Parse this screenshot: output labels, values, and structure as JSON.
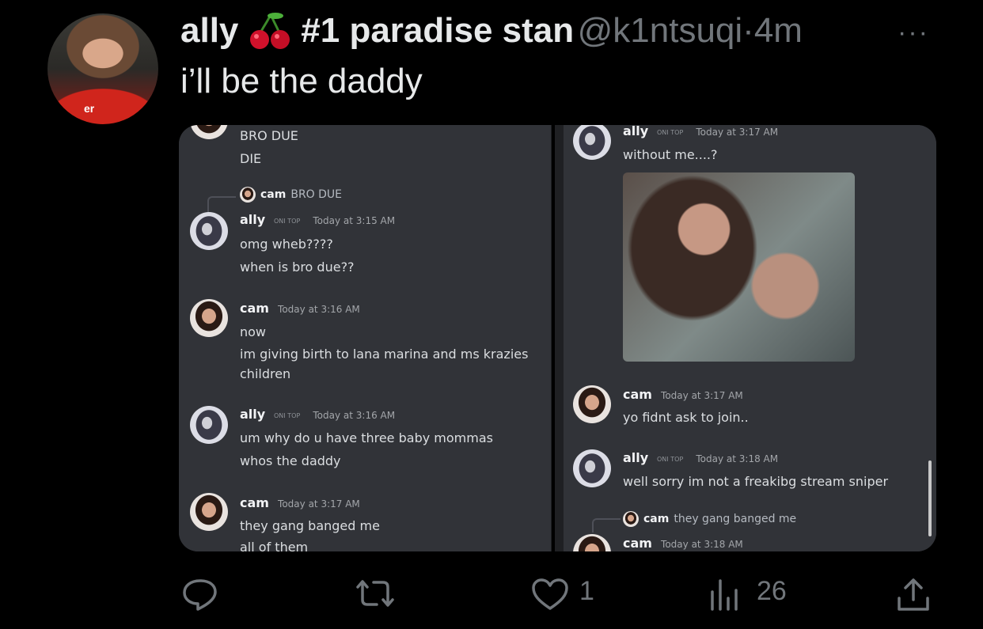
{
  "tweet": {
    "author_name": "ally",
    "author_suffix": "#1 paradise stan",
    "handle": "@k1ntsuqi",
    "separator": "·",
    "time": "4m",
    "more": "···",
    "text": "i’ll be the daddy",
    "avatar_badge": "er"
  },
  "left_panel": {
    "top_lines": [
      "BRO DUE",
      "DIE"
    ],
    "reply1": {
      "user": "cam",
      "text": "BRO DUE"
    },
    "messages": [
      {
        "user": "ally",
        "tags": [
          "ONI",
          "TOP"
        ],
        "time": "Today at 3:15 AM",
        "lines": [
          "omg wheb????",
          "when is bro due??"
        ]
      },
      {
        "user": "cam",
        "time": "Today at 3:16 AM",
        "lines": [
          "now",
          "im giving birth to lana marina and ms krazies",
          "children"
        ]
      },
      {
        "user": "ally",
        "tags": [
          "ONI",
          "TOP"
        ],
        "time": "Today at 3:16 AM",
        "lines": [
          "um why do u have three baby mommas",
          "whos the daddy"
        ]
      },
      {
        "user": "cam",
        "time": "Today at 3:17 AM",
        "lines": [
          "they gang banged me",
          "all of them"
        ]
      }
    ]
  },
  "right_panel": {
    "messages": [
      {
        "user": "ally",
        "tags": [
          "ONI",
          "TOP"
        ],
        "time": "Today at 3:17 AM",
        "lines": [
          "without me....?"
        ]
      },
      {
        "user": "cam",
        "time": "Today at 3:17 AM",
        "lines": [
          "yo fidnt ask to join.."
        ]
      },
      {
        "user": "ally",
        "tags": [
          "ONI",
          "TOP"
        ],
        "time": "Today at 3:18 AM",
        "lines": [
          "well sorry im not a freakibg stream sniper"
        ]
      },
      {
        "user": "cam",
        "time": "Today at 3:18 AM",
        "lines": []
      }
    ],
    "reply": {
      "user": "cam",
      "text": "they gang banged me"
    }
  },
  "actions": {
    "likes": "1",
    "views": "26"
  },
  "colors": {
    "background": "#000000",
    "discord_bg": "#313338",
    "muted": "#71767b"
  }
}
